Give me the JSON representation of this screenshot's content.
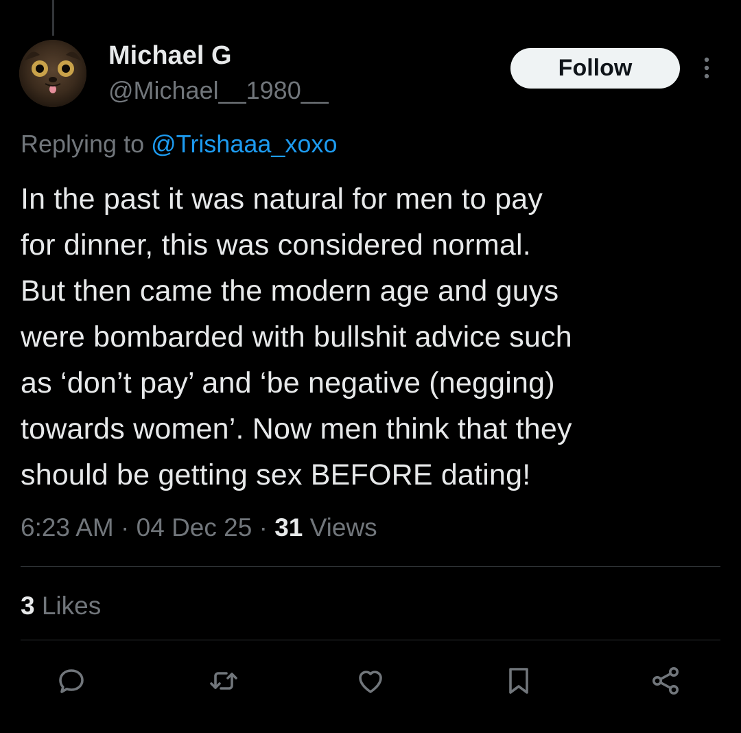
{
  "colors": {
    "background": "#000000",
    "text_primary": "#e7e9ea",
    "text_secondary": "#71767b",
    "link": "#1d9bf0",
    "follow_bg": "#eff3f4",
    "divider": "#2f3336"
  },
  "tweet": {
    "author": {
      "display_name": "Michael G",
      "handle": "@Michael__1980__",
      "avatar": "cat-avatar"
    },
    "follow_label": "Follow",
    "more_icon": "more-vertical-icon",
    "replying_to": {
      "prefix": "Replying to",
      "mention": "@Trishaaa_xoxo"
    },
    "text_lines": [
      "In the past it was natural for men to pay",
      "for dinner, this was considered normal.",
      "But then came the modern age and guys",
      "were bombarded with bullshit advice such",
      "as ‘don’t pay’ and ‘be negative (negging)",
      "towards women’. Now men think that they",
      "should be getting sex BEFORE dating!"
    ],
    "meta": {
      "time": "6:23 AM",
      "separator1": "·",
      "date": "04 Dec 25",
      "separator2": "·",
      "views_count": "31",
      "views_label": "Views"
    },
    "likes": {
      "count": "3",
      "label": "Likes"
    },
    "actions": [
      {
        "name": "reply",
        "icon": "reply-icon"
      },
      {
        "name": "retweet",
        "icon": "retweet-icon"
      },
      {
        "name": "like",
        "icon": "heart-icon"
      },
      {
        "name": "bookmark",
        "icon": "bookmark-icon"
      },
      {
        "name": "share",
        "icon": "share-icon"
      }
    ]
  }
}
